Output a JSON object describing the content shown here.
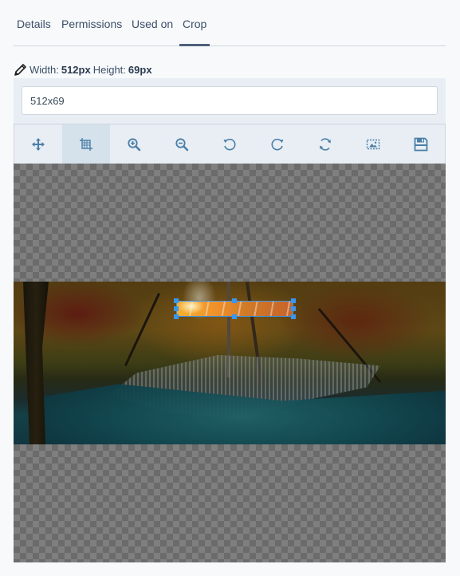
{
  "tabs": [
    {
      "label": "Details",
      "active": false
    },
    {
      "label": "Permissions",
      "active": false
    },
    {
      "label": "Used on",
      "active": false
    },
    {
      "label": "Crop",
      "active": true
    }
  ],
  "dimensions": {
    "width_label": "Width:",
    "width_value": "512px",
    "height_label": "Height:",
    "height_value": "69px"
  },
  "size_input": {
    "value": "512x69"
  },
  "toolbar": {
    "tools": [
      {
        "name": "move",
        "icon": "move-arrows-icon",
        "active": false
      },
      {
        "name": "crop",
        "icon": "crop-icon",
        "active": true
      },
      {
        "name": "zoom-in",
        "icon": "zoom-in-icon",
        "active": false
      },
      {
        "name": "zoom-out",
        "icon": "zoom-out-icon",
        "active": false
      },
      {
        "name": "rotate-left",
        "icon": "rotate-left-icon",
        "active": false
      },
      {
        "name": "rotate-right",
        "icon": "rotate-right-icon",
        "active": false
      },
      {
        "name": "reset",
        "icon": "reset-icon",
        "active": false
      },
      {
        "name": "fit-image",
        "icon": "image-select-icon",
        "active": false
      },
      {
        "name": "save",
        "icon": "save-icon",
        "active": false
      }
    ]
  },
  "colors": {
    "accent": "#3996f0",
    "icon": "#4a7fa8",
    "tab_underline": "#4d5f7a",
    "panel_bg": "#e8eef3",
    "tool_active_bg": "#d5e2ec"
  }
}
